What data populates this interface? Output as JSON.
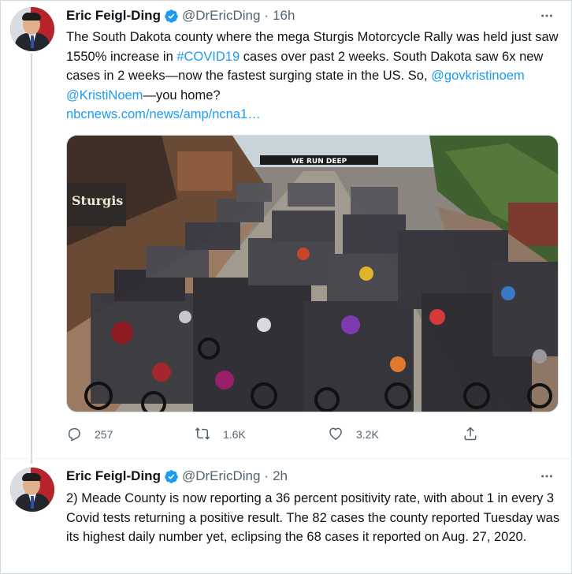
{
  "colors": {
    "accent": "#1d9bf0",
    "text_primary": "#0f1419",
    "text_secondary": "#536471",
    "border": "#cfd9de"
  },
  "tweets": [
    {
      "author": {
        "name": "Eric Feigl-Ding",
        "handle": "@DrEricDing",
        "verified_icon": "verified-badge-icon",
        "avatar": "profile-avatar"
      },
      "separator": "·",
      "time": "16h",
      "text": {
        "seg1": "The South Dakota county where the mega Sturgis Motorcycle Rally was held just saw 1550% increase in ",
        "hashtag": "#COVID19",
        "seg2": " cases over past 2 weeks. South Dakota saw 6x new cases in 2 weeks—now the fastest surging state in the US. So, ",
        "mention1": "@govkristinoem",
        "space": " ",
        "mention2": "@KristiNoem",
        "seg3": "—you home?",
        "url": "nbcnews.com/news/amp/ncna1…"
      },
      "image": {
        "description_icon": "photo-sturgis-rally",
        "sign_text": "WE RUN DEEP",
        "storefront_text": "Sturgis"
      },
      "actions": {
        "replies": "257",
        "retweets": "1.6K",
        "likes": "3.2K"
      }
    },
    {
      "author": {
        "name": "Eric Feigl-Ding",
        "handle": "@DrEricDing",
        "verified_icon": "verified-badge-icon",
        "avatar": "profile-avatar"
      },
      "separator": "·",
      "time": "2h",
      "text": {
        "body": "2) Meade County is now reporting a 36 percent positivity rate, with about 1 in every 3 Covid tests returning a positive result. The 82 cases the county reported Tuesday was its highest daily number yet, eclipsing the 68 cases it reported on Aug. 27, 2020."
      }
    }
  ]
}
